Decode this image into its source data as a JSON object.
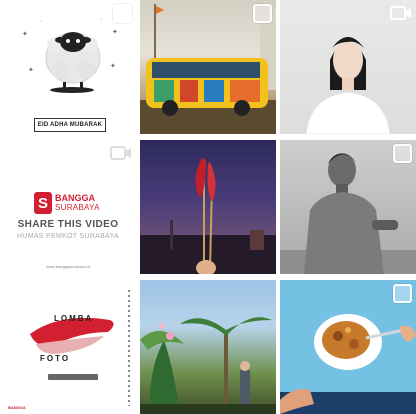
{
  "grid": {
    "posts": [
      {
        "id": "post-eid",
        "caption": "EID ADHA MUBARAK",
        "media": "image"
      },
      {
        "id": "post-bus",
        "media": "image"
      },
      {
        "id": "post-portrait-woman",
        "media": "image"
      },
      {
        "id": "post-bangga",
        "media": "video",
        "brand_line1": "BANGGA",
        "brand_line2": "SURABAYA",
        "headline": "SHARE THIS VIDEO",
        "subline": "HUMAS PEMKOT SURABAYA",
        "url": "www.banggasurabaya.id"
      },
      {
        "id": "post-chili",
        "media": "image"
      },
      {
        "id": "post-portrait-man",
        "media": "image"
      },
      {
        "id": "post-lomba",
        "media": "image",
        "word1": "LOMBA",
        "word2": "FOTO"
      },
      {
        "id": "post-plants",
        "media": "image"
      },
      {
        "id": "post-food",
        "media": "image"
      }
    ]
  },
  "colors": {
    "brand_red": "#d22030",
    "select_box": "#ffffff",
    "sky_blue": "#74c1e3"
  },
  "icons": {
    "select": "select-checkbox-icon",
    "video": "video-camera-icon"
  }
}
